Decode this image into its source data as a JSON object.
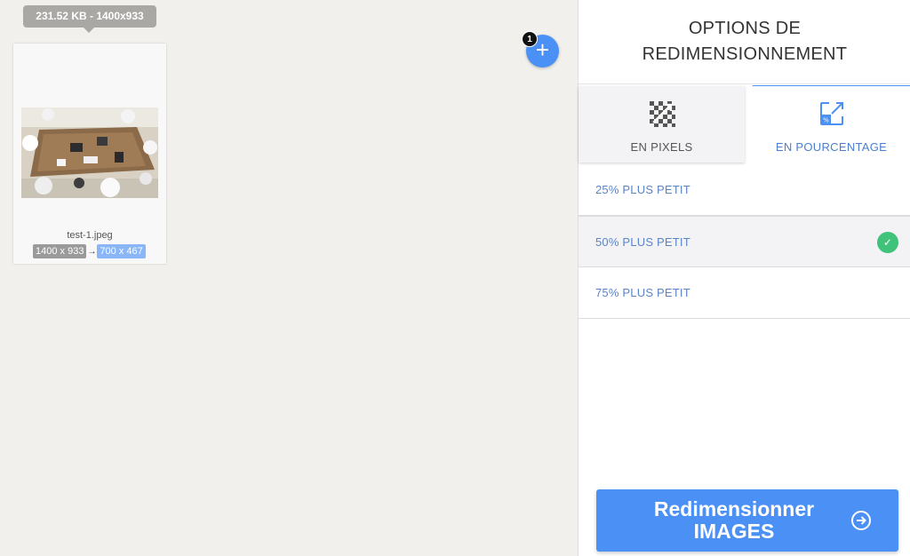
{
  "workspace": {
    "tooltip": "231.52 KB - 1400x933",
    "file": {
      "name": "test-1.jpeg",
      "original_dims": "1400 x 933",
      "arrow": "→",
      "new_dims": "700 x 467"
    },
    "add_button": {
      "icon": "plus-icon",
      "symbol": "+",
      "badge_count": "1"
    }
  },
  "sidebar": {
    "title_line1": "OPTIONS DE",
    "title_line2": "REDIMENSIONNEMENT",
    "tabs": [
      {
        "label": "EN PIXELS",
        "icon": "pixels-icon",
        "active": false
      },
      {
        "label": "EN POURCENTAGE",
        "icon": "percent-resize-icon",
        "active": true
      }
    ],
    "options": [
      {
        "label": "25% PLUS PETIT",
        "selected": false
      },
      {
        "label": "50% PLUS PETIT",
        "selected": true
      },
      {
        "label": "75% PLUS PETIT",
        "selected": false
      }
    ],
    "check_symbol": "✓",
    "resize_button": {
      "line1": "Redimensionner",
      "line2": "IMAGES",
      "icon": "arrow-right-circle-icon"
    }
  },
  "colors": {
    "accent": "#4a90f5",
    "success": "#3fc27a",
    "workspace_bg": "#f2f0ec"
  }
}
